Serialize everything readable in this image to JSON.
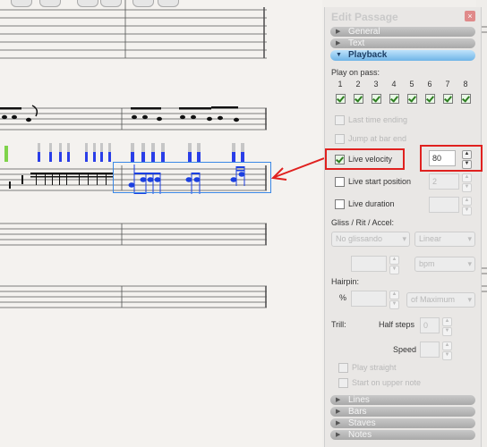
{
  "panel": {
    "title": "Edit Passage",
    "close_glyph": "×",
    "sections_top": [
      {
        "label": "General",
        "state": "collapsed"
      },
      {
        "label": "Text",
        "state": "collapsed"
      },
      {
        "label": "Playback",
        "state": "expanded"
      }
    ],
    "sections_bottom": [
      {
        "label": "Lines"
      },
      {
        "label": "Bars"
      },
      {
        "label": "Staves"
      },
      {
        "label": "Notes"
      }
    ],
    "playback": {
      "play_on_pass_label": "Play on pass:",
      "passes": [
        "1",
        "2",
        "3",
        "4",
        "5",
        "6",
        "7",
        "8"
      ],
      "passes_checked": [
        true,
        true,
        true,
        true,
        true,
        true,
        true,
        true
      ],
      "last_time_ending": "Last time ending",
      "jump_at_bar_end": "Jump at bar end",
      "live_velocity": "Live velocity",
      "live_velocity_checked": true,
      "velocity_value": "80",
      "live_start_position": "Live start position",
      "start_position_value": "2",
      "live_duration": "Live duration",
      "gliss_label": "Gliss / Rit / Accel:",
      "gliss_select": "No glissando",
      "linear_select": "Linear",
      "bpm_select": "bpm",
      "hairpin_label": "Hairpin:",
      "percent_label": "%",
      "maximum_select": "of Maximum",
      "trill_label": "Trill:",
      "half_steps_label": "Half steps",
      "half_steps_value": "0",
      "speed_label": "Speed",
      "play_straight": "Play straight",
      "start_on_upper_note": "Start on upper note"
    }
  },
  "colors": {
    "highlight_red": "#e0211f",
    "selection_blue": "#3a88e6",
    "note_blue": "#1b3fe0",
    "velocity_bar_blue": "#2a3ee8",
    "playback_header": "#6fb4e7"
  }
}
